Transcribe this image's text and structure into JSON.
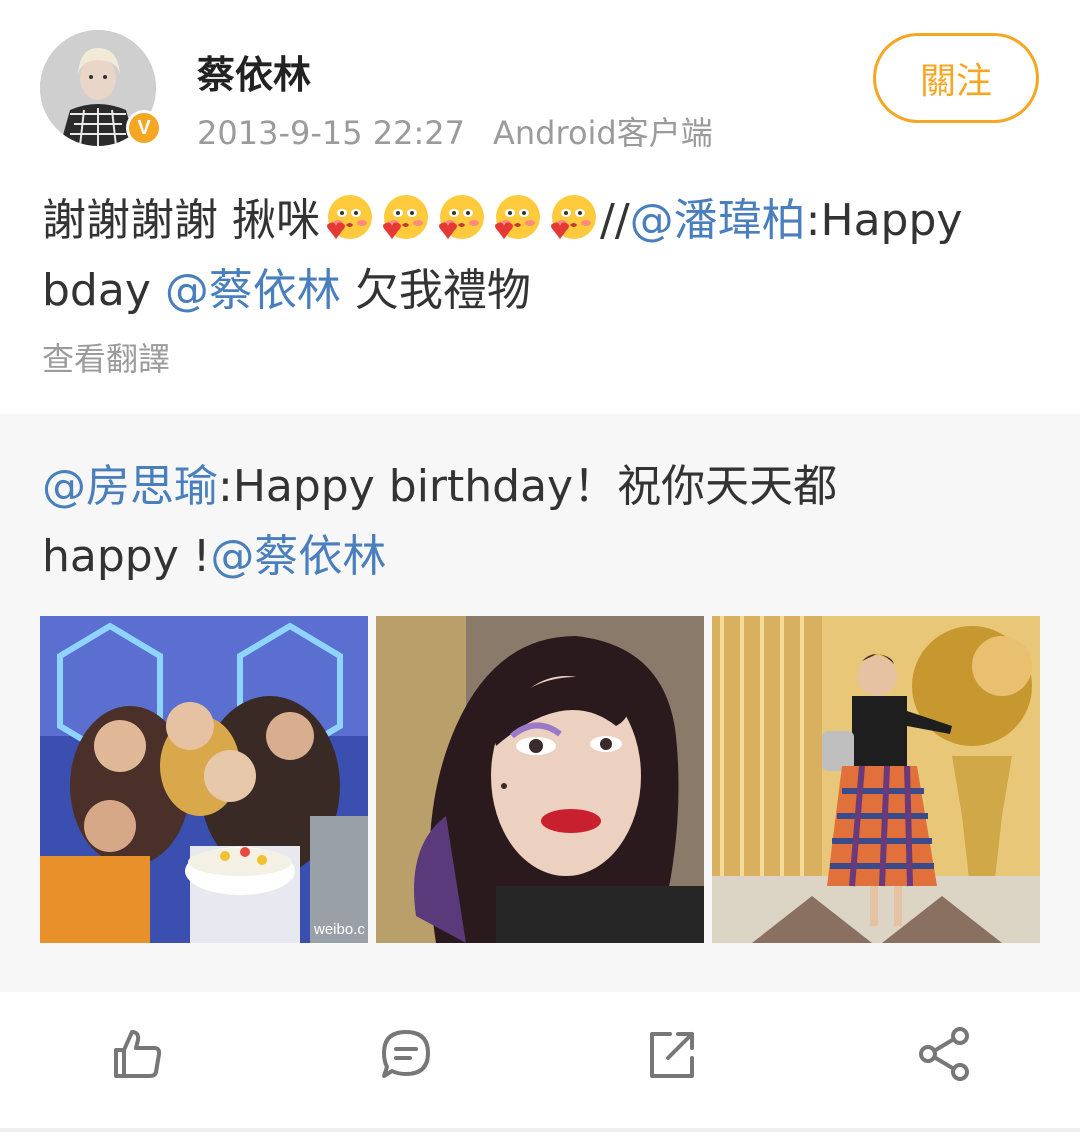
{
  "post": {
    "author": "蔡依林",
    "timestamp": "2013-9-15 22:27",
    "source": "Android客户端",
    "follow_label": "關注",
    "verified_badge": "V",
    "text_prefix": "謝謝謝謝 揪咪",
    "emoji_count": 5,
    "emoji_name": "kiss-heart-emoji",
    "separator": "//",
    "mention_1": "@潘瑋柏",
    "text_middle_a": ":Happy",
    "text_middle_b": "bday ",
    "mention_2": "@蔡依林",
    "text_suffix": " 欠我禮物",
    "translate_label": "查看翻譯"
  },
  "repost": {
    "mention_1": "@房思瑜",
    "text_a": ":Happy birthday！祝你天天都",
    "text_b": "happy !",
    "mention_2": "@蔡依林",
    "photo_1_watermark": "weibo.c"
  },
  "actions": [
    "like-icon",
    "comment-icon",
    "repost-icon",
    "share-icon"
  ],
  "colors": {
    "accent_orange": "#f5a623",
    "mention_blue": "#4a7fbd",
    "muted_gray": "#9b9b9b",
    "repost_bg": "#f7f7f7"
  }
}
